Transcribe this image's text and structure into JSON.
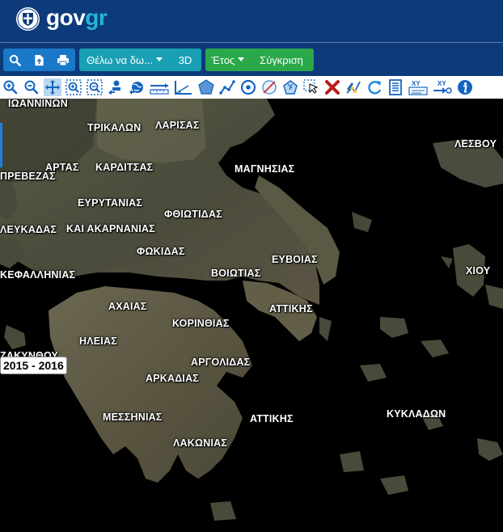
{
  "header": {
    "logo_text_left": "gov",
    "logo_text_right": "gr",
    "accent_color": "#25b5d8",
    "background_color": "#0d3a7a"
  },
  "toolbar": {
    "icons": [
      "search-icon",
      "file-import-icon",
      "print-icon"
    ],
    "want_dropdown_label": "Θέλω να δω...",
    "view3d_label": "3D",
    "year_dropdown_label": "Έτος",
    "compare_label": "Σύγκριση"
  },
  "tools": [
    "zoom-in-icon",
    "zoom-out-icon",
    "pan-icon",
    "zoom-box-in-icon",
    "zoom-box-out-icon",
    "street-view-icon",
    "globe-icon",
    "measure-distance-icon",
    "measure-angle-icon",
    "draw-polygon-icon",
    "draw-line-icon",
    "draw-circle-icon",
    "clear-drawing-icon",
    "select-shape-icon",
    "select-pointer-icon",
    "delete-icon",
    "edit-vertices-icon",
    "refresh-icon",
    "document-icon",
    "coordinates-xy-icon",
    "goto-xy-icon",
    "info-icon"
  ],
  "map": {
    "year_badge": "2015 - 2016",
    "labels": [
      {
        "text": "ΙΩΑΝΝΙΝΩΝ"
      },
      {
        "text": "ΤΡΙΚΑΛΩΝ"
      },
      {
        "text": "ΛΑΡΙΣΑΣ"
      },
      {
        "text": "ΛΕΣΒΟΥ"
      },
      {
        "text": "ΠΡΕΒΕΖΑΣ"
      },
      {
        "text": "ΑΡΤΑΣ"
      },
      {
        "text": "ΚΑΡΔΙΤΣΑΣ"
      },
      {
        "text": "ΜΑΓΝΗΣΙΑΣ"
      },
      {
        "text": "ΕΥΡΥΤΑΝΙΑΣ"
      },
      {
        "text": "ΦΘΙΩΤΙΔΑΣ"
      },
      {
        "text": "ΛΕΥΚΑΔΑΣ"
      },
      {
        "text": "ΚΑΙ ΑΚΑΡΝΑΝΙΑΣ"
      },
      {
        "text": "ΦΩΚΙΔΑΣ"
      },
      {
        "text": "ΕΥΒΟΙΑΣ"
      },
      {
        "text": "ΧΙΟΥ"
      },
      {
        "text": "ΚΕΦΑΛΛΗΝΙΑΣ"
      },
      {
        "text": "ΒΟΙΩΤΙΑΣ"
      },
      {
        "text": "ΑΧΑΙΑΣ"
      },
      {
        "text": "ΑΤΤΙΚΗΣ"
      },
      {
        "text": "ΚΟΡΙΝΘΙΑΣ"
      },
      {
        "text": "ΗΛΕΙΑΣ"
      },
      {
        "text": "ΖΑΚΥΝΘΟΥ"
      },
      {
        "text": "ΑΡΓΟΛΙΔΑΣ"
      },
      {
        "text": "ΑΡΚΑΔΙΑΣ"
      },
      {
        "text": "ΜΕΣΣΗΝΙΑΣ"
      },
      {
        "text": "ΑΤΤΙΚΗΣ"
      },
      {
        "text": "ΚΥΚΛΑΔΩΝ"
      },
      {
        "text": "ΛΑΚΩΝΙΑΣ"
      }
    ]
  }
}
